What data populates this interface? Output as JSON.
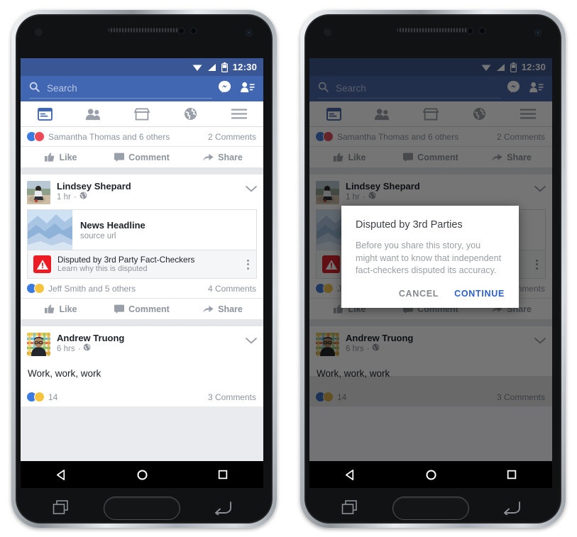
{
  "status_bar": {
    "time": "12:30",
    "icons": [
      "wifi-icon",
      "signal-icon",
      "battery-icon"
    ]
  },
  "header": {
    "search_placeholder": "Search",
    "search_value": "",
    "icons": [
      "search-icon",
      "messenger-icon",
      "friend-requests-icon"
    ]
  },
  "tabs": [
    {
      "name": "news-feed",
      "icon": "news-feed-icon",
      "active": true
    },
    {
      "name": "friends",
      "icon": "friends-icon",
      "active": false
    },
    {
      "name": "marketplace",
      "icon": "marketplace-icon",
      "active": false
    },
    {
      "name": "notifications",
      "icon": "globe-icon",
      "active": false
    },
    {
      "name": "more",
      "icon": "hamburger-menu-icon",
      "active": false
    }
  ],
  "top_post": {
    "reactions_text": "Samantha Thomas and 6 others",
    "comments_text": "2 Comments",
    "reactions": [
      "like",
      "love"
    ]
  },
  "actions": {
    "like": "Like",
    "comment": "Comment",
    "share": "Share"
  },
  "post_one": {
    "author": "Lindsey Shepard",
    "time": "1 hr",
    "privacy_icon": "globe-privacy-icon",
    "link_card": {
      "title": "News Headline",
      "url": "source url"
    },
    "disputed": {
      "title": "Disputed by 3rd Party Fact-Checkers",
      "subtitle": "Learn why this is disputed",
      "icon": "warning-triangle-icon",
      "color": "#ed1c24"
    },
    "reactions_text": "Jeff Smith and 5 others",
    "comments_text": "4 Comments",
    "reactions": [
      "like",
      "wow"
    ]
  },
  "post_two": {
    "author": "Andrew Truong",
    "time": "6 hrs",
    "privacy_icon": "globe-privacy-icon",
    "text": "Work, work, work",
    "reactions_count": "14",
    "comments_text": "3 Comments",
    "reactions": [
      "like",
      "wow"
    ]
  },
  "dialog": {
    "title": "Disputed by 3rd Parties",
    "body": "Before you share this story, you might want to know that independent fact-checkers disputed its accuracy.",
    "cancel_label": "CANCEL",
    "continue_label": "CONTINUE",
    "continue_color": "#2a5fd6"
  },
  "nav_bar": {
    "back": "back-icon",
    "home": "home-icon",
    "recents": "recents-icon"
  },
  "hardware_keys": {
    "recents": "recents-key",
    "home": "home-key",
    "back": "back-key"
  },
  "theme": {
    "fb_blue": "#4267b2",
    "status_blue": "#3a5795",
    "bg_gray": "#e9ebee"
  }
}
